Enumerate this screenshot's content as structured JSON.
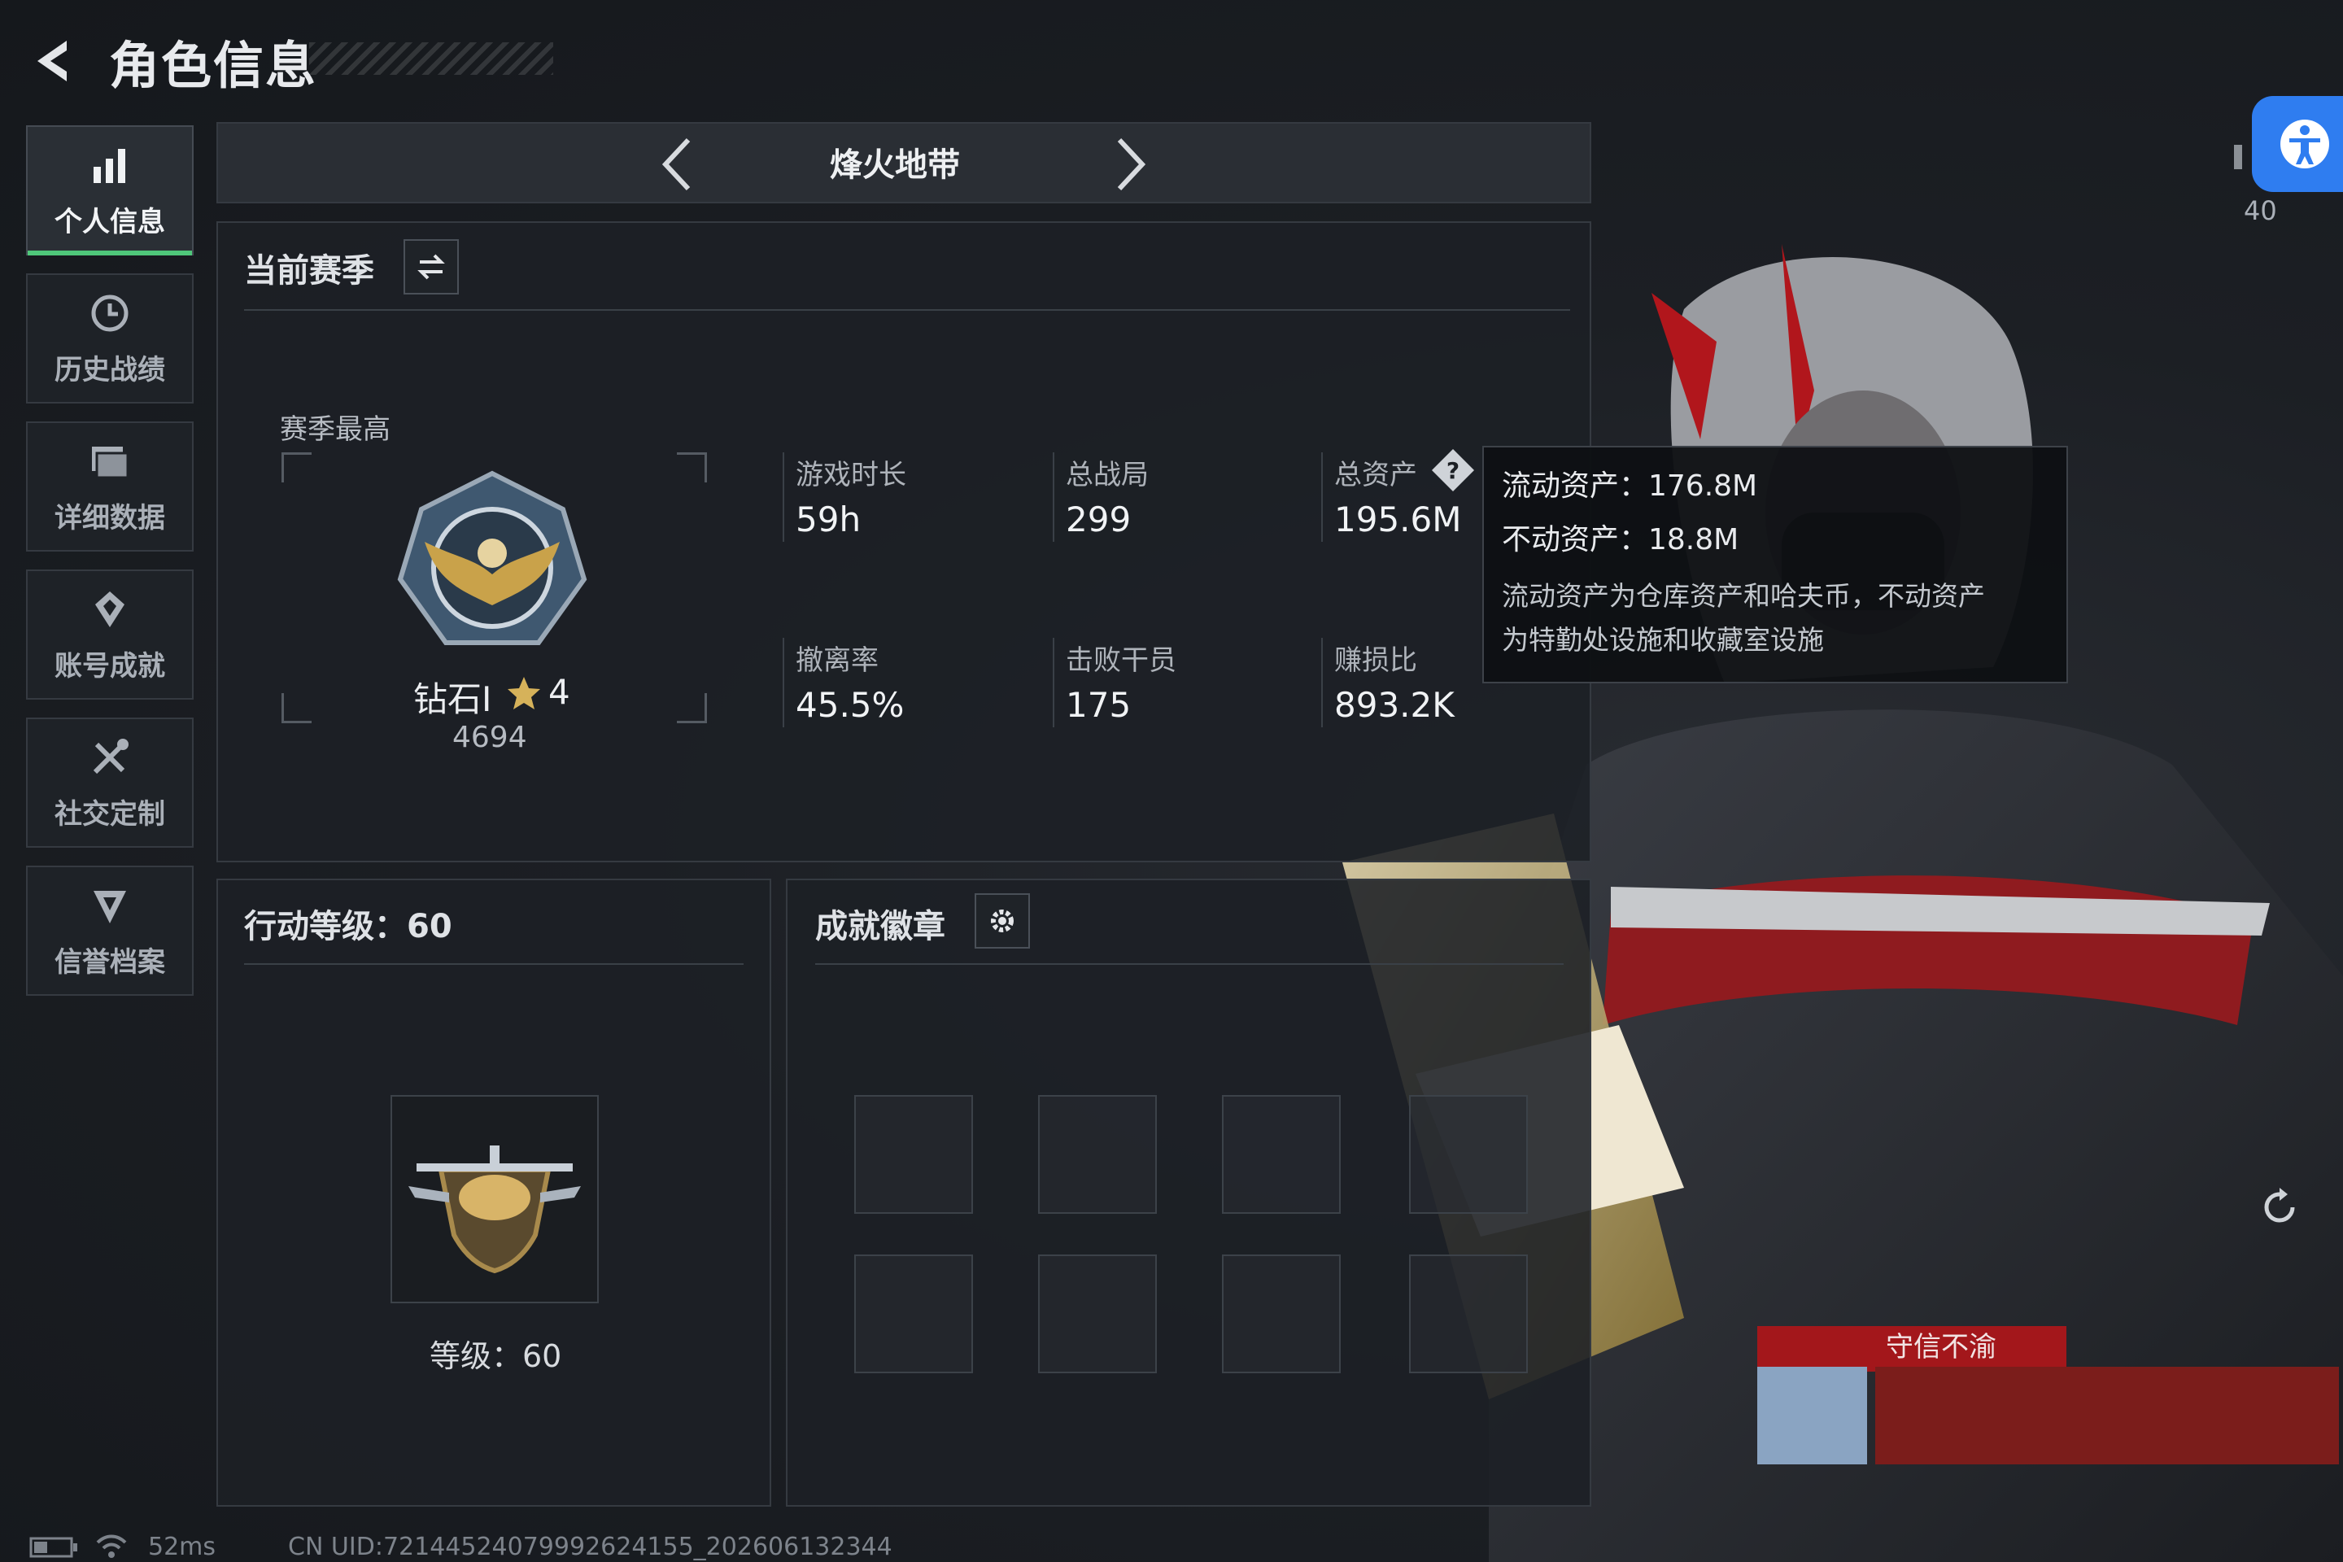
{
  "header": {
    "title": "角色信息"
  },
  "sidebar": {
    "items": [
      {
        "label": "个人信息",
        "icon": "bar-chart-icon",
        "active": true
      },
      {
        "label": "历史战绩",
        "icon": "history-clock-icon",
        "active": false
      },
      {
        "label": "详细数据",
        "icon": "folder-icon",
        "active": false
      },
      {
        "label": "账号成就",
        "icon": "achievement-icon",
        "active": false
      },
      {
        "label": "社交定制",
        "icon": "tools-icon",
        "active": false
      },
      {
        "label": "信誉档案",
        "icon": "credit-shield-icon",
        "active": false
      }
    ]
  },
  "mode": {
    "title": "烽火地带"
  },
  "season": {
    "title": "当前赛季",
    "best_label": "赛季最高",
    "rank_name": "钻石I",
    "rank_stars": "4",
    "rank_score": "4694",
    "stats": [
      {
        "label": "游戏时长",
        "value": "59h"
      },
      {
        "label": "总战局",
        "value": "299"
      },
      {
        "label": "总资产",
        "value": "195.6M"
      },
      {
        "label": "撤离率",
        "value": "45.5%"
      },
      {
        "label": "击败干员",
        "value": "175"
      },
      {
        "label": "赚损比",
        "value": "893.2K"
      }
    ]
  },
  "tooltip": {
    "line1": "流动资产：176.8M",
    "line2": "不动资产：18.8M",
    "note1": "流动资产为仓库资产和哈夫币，不动资产",
    "note2": "为特勤处设施和收藏室设施"
  },
  "level": {
    "title": "行动等级：60",
    "label": "等级：60"
  },
  "badges": {
    "title": "成就徽章",
    "slot_count": 8
  },
  "character": {
    "tag": "守信不渝"
  },
  "status": {
    "right_value": "40",
    "ping": "52ms",
    "uid": "CN UID:72144524079992624155_202606132344"
  },
  "colors": {
    "accent_green": "#4fc77a",
    "accessibility_blue": "#2f7df0",
    "tag_red": "#a3171b"
  }
}
